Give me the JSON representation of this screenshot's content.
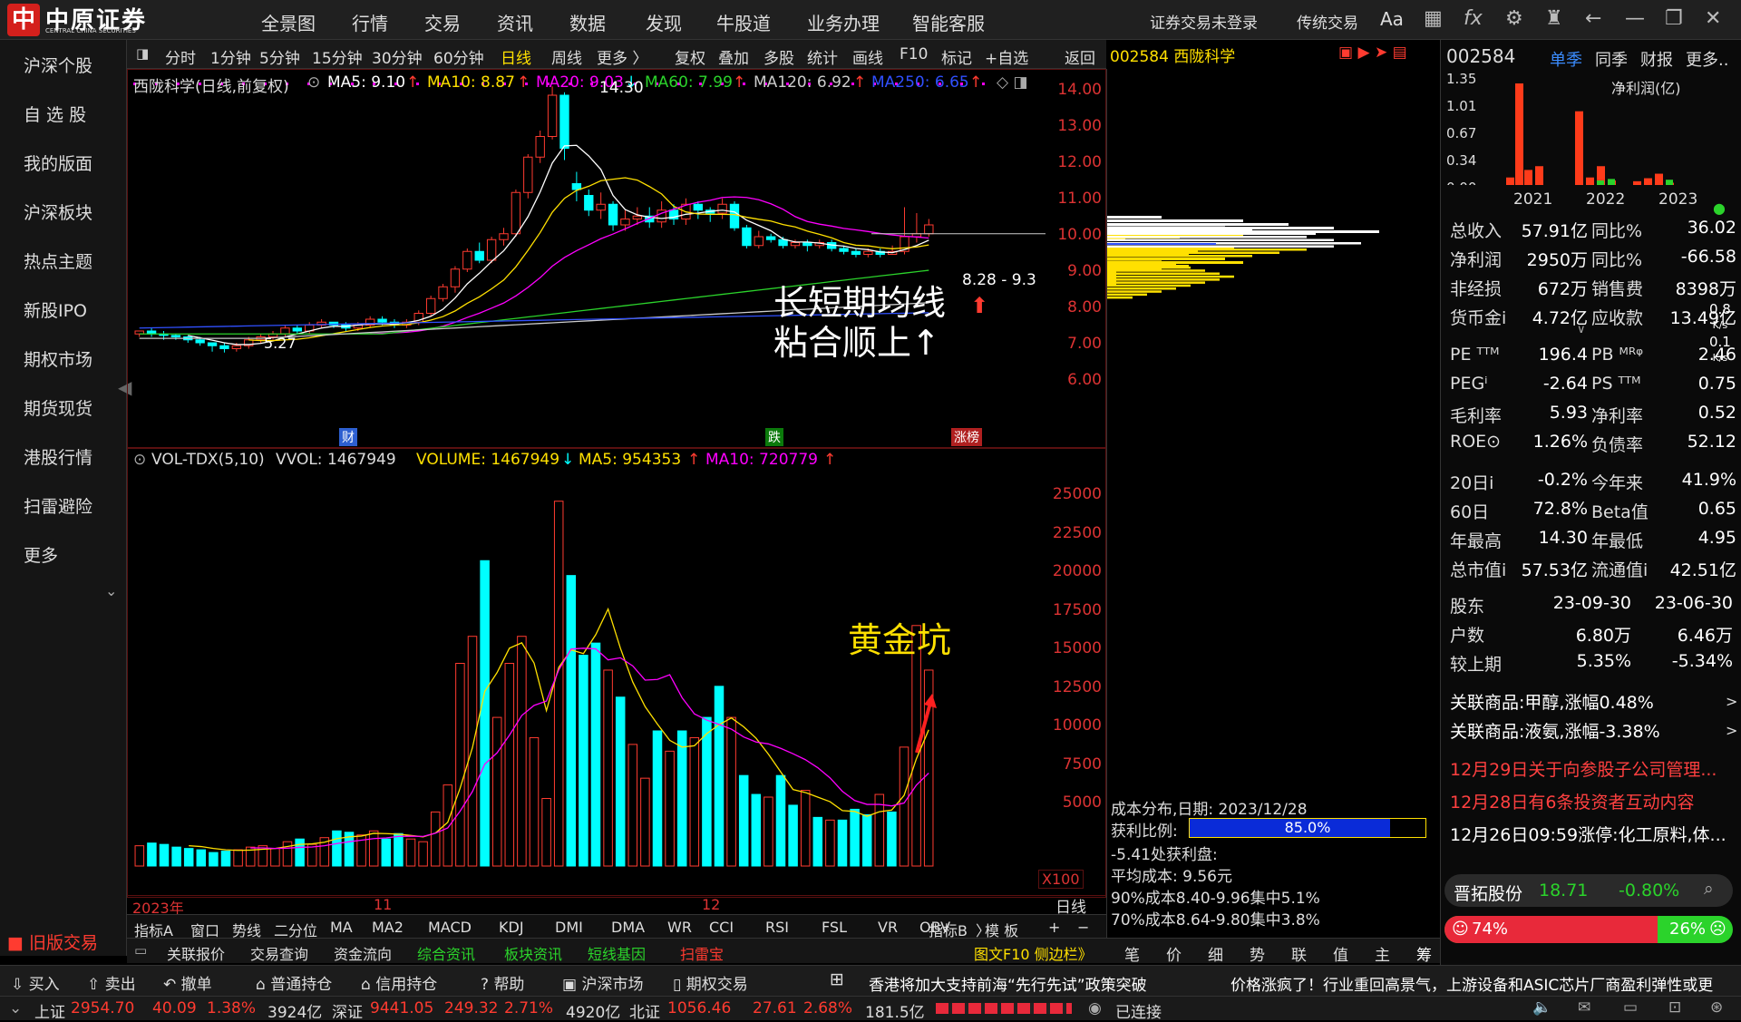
{
  "app": {
    "logo_char": "中",
    "logo_name": "中原证券",
    "logo_sub": "CENTRAL CHINA SECURITIES"
  },
  "topmenu": [
    "全景图",
    "行情",
    "交易",
    "资讯",
    "数据",
    "发现",
    "牛股道",
    "业务办理",
    "智能客服"
  ],
  "topright": {
    "login": "证券交易未登录",
    "traditional": "传统交易",
    "font": "Aa"
  },
  "sidebar": [
    "沪深个股",
    "自 选 股",
    "我的版面",
    "沪深板块",
    "热点主题",
    "新股IPO",
    "期权市场",
    "期货现货",
    "港股行情",
    "扫雷避险",
    "更多"
  ],
  "sidebar_old": "旧版交易",
  "chartbar": [
    "分时",
    "1分钟",
    "5分钟",
    "15分钟",
    "30分钟",
    "60分钟",
    "日线",
    "周线",
    "更多 〉",
    "复权",
    "叠加",
    "多股",
    "统计",
    "画线",
    "F10",
    "标记",
    "+自选",
    "返回"
  ],
  "stock": {
    "code": "002584",
    "name": "西陇科学"
  },
  "kline": {
    "title": "西陇科学(日线,前复权)",
    "ma5": "MA5: 9.10",
    "ma10": "MA10: 8.87",
    "ma20": "MA20: 9.03",
    "ma60": "MA60: 7.99",
    "ma120": "MA120: 6.92",
    "ma250": "MA250: 6.65",
    "yaxis": [
      "14.00",
      "13.00",
      "12.00",
      "11.00",
      "10.00",
      "9.00",
      "8.00",
      "7.00",
      "6.00"
    ],
    "high": "14.30",
    "low": "5.27",
    "range": "8.28 - 9.3",
    "tag_cai": "财",
    "tag_die": "跌",
    "tag_zhang": "涨榜",
    "annot1": "长短期均线",
    "annot2": "粘合顺上↑"
  },
  "volume": {
    "title": "VOL-TDX(5,10)",
    "vvol": "VVOL: 1467949",
    "vol": "VOLUME: 1467949",
    "ma5": "MA5: 954353",
    "ma10": "MA10: 720779",
    "yaxis": [
      "25000",
      "22500",
      "20000",
      "17500",
      "15000",
      "12500",
      "10000",
      "7500",
      "5000"
    ],
    "unit": "X100",
    "annot": "黄金坑",
    "period": "日线"
  },
  "xaxis": [
    "2023年",
    "11",
    "12"
  ],
  "indicators": [
    "指标A",
    "窗口",
    "势线",
    "二分位",
    "MA",
    "MA2",
    "MACD",
    "KDJ",
    "DMI",
    "DMA",
    "WR",
    "CCI",
    "RSI",
    "FSL",
    "VR",
    "OBV",
    "〉"
  ],
  "indicators_right": [
    "指标B",
    "模 板",
    "+",
    "−"
  ],
  "bottomtabs": [
    "关联报价",
    "交易查询",
    "资金流向",
    "综合资讯",
    "板块资讯",
    "短线基因",
    "扫雷宝"
  ],
  "f10": "图文F10 侧边栏》",
  "chip": {
    "date": "成本分布,日期: 2023/12/28",
    "profit_label": "获利比例:",
    "profit": "85.0%",
    "profit_pct": 0.85,
    "line1": "-5.41处获利盘:",
    "avg": "平均成本: 9.56元",
    "c90": "90%成本8.40-9.96集中5.1%",
    "c70": "70%成本8.64-9.80集中3.8%",
    "tabs": [
      "笔",
      "价",
      "细",
      "势",
      "联",
      "值",
      "主",
      "筹"
    ]
  },
  "right": {
    "code": "002584",
    "tabs": [
      "单季",
      "同季",
      "财报",
      "更多.."
    ],
    "metric": "净利润(亿)",
    "yaxis": [
      "1.35",
      "1.01",
      "0.67",
      "0.34",
      "0.00"
    ],
    "years": [
      "2021",
      "2022",
      "2023"
    ],
    "rows": [
      [
        "总收入",
        "57.91亿",
        "同比%",
        "36.02"
      ],
      [
        "净利润",
        "2950万",
        "同比%",
        "-66.58"
      ],
      [
        "非经损",
        "672万",
        "销售费",
        "8398万"
      ],
      [
        "货币金i",
        "4.72亿",
        "应收款",
        "13.49亿"
      ]
    ],
    "rows2": [
      [
        "PE ᵀᵀᴹ",
        "196.4",
        "PB ᴹᴿᵠ",
        "2.46"
      ],
      [
        "PEGⁱ",
        "-2.64",
        "PS ᵀᵀᴹ",
        "0.75"
      ],
      [
        "毛利率",
        "5.93",
        "净利率",
        "0.52"
      ],
      [
        "ROE⊙",
        "1.26%",
        "负债率",
        "52.12"
      ]
    ],
    "rows3": [
      [
        "20日i",
        "-0.2%",
        "今年来",
        "41.9%"
      ],
      [
        "60日",
        "72.8%",
        "Beta值",
        "0.65"
      ],
      [
        "年最高",
        "14.30",
        "年最低",
        "4.95"
      ],
      [
        "总市值i",
        "57.53亿",
        "流通值i",
        "42.51亿"
      ]
    ],
    "holders": [
      [
        "股东",
        "23-09-30",
        "23-06-30"
      ],
      [
        "户数",
        "6.80万",
        "6.46万"
      ],
      [
        "较上期",
        "5.35%",
        "-5.34%"
      ]
    ],
    "related": [
      "关联商品:甲醇,涨幅0.48%",
      "关联商品:液氨,涨幅-3.38%"
    ],
    "news": [
      "12月29日关于向参股子公司管理...",
      "12月28日有6条投资者互动内容",
      "12月26日09:59涨停:化工原料,体..."
    ],
    "peer": {
      "name": "晋拓股份",
      "price": "18.71",
      "change": "-0.80%"
    },
    "bull": "74%",
    "bear": "26%",
    "bull_pct": 0.74,
    "side_small": [
      "0.8",
      "K/s",
      "0.1",
      "K/s"
    ]
  },
  "actionbar": [
    "买入",
    "卖出",
    "撤单",
    "普通持仓",
    "信用持仓",
    "帮助",
    "沪深市场",
    "期权交易"
  ],
  "ticker": "香港将加大支持前海“先行先试”政策突破",
  "ticker2": "价格涨疯了！行业重回高景气，上游设备和ASIC芯片厂商盈利弹性或更",
  "status": {
    "sh": "上证",
    "sh_v": "2954.70",
    "sh_c": "40.09",
    "sh_p": "1.38%",
    "sh_a": "3924亿",
    "sz": "深证",
    "sz_v": "9441.05",
    "sz_c": "249.32",
    "sz_p": "2.71%",
    "sz_a": "4920亿",
    "bz": "北证",
    "bz_v": "1056.46",
    "bz_c": "27.61",
    "bz_p": "2.68%",
    "bz_a": "181.5亿",
    "conn": "已连接"
  },
  "colors": {
    "up": "#ff3b30",
    "down": "#00ffff",
    "ma5": "#ffffff",
    "ma10": "#ffe000",
    "ma20": "#ff00ff",
    "ma60": "#2bd32b",
    "ma120": "#cccccc",
    "ma250": "#3050ff"
  }
}
